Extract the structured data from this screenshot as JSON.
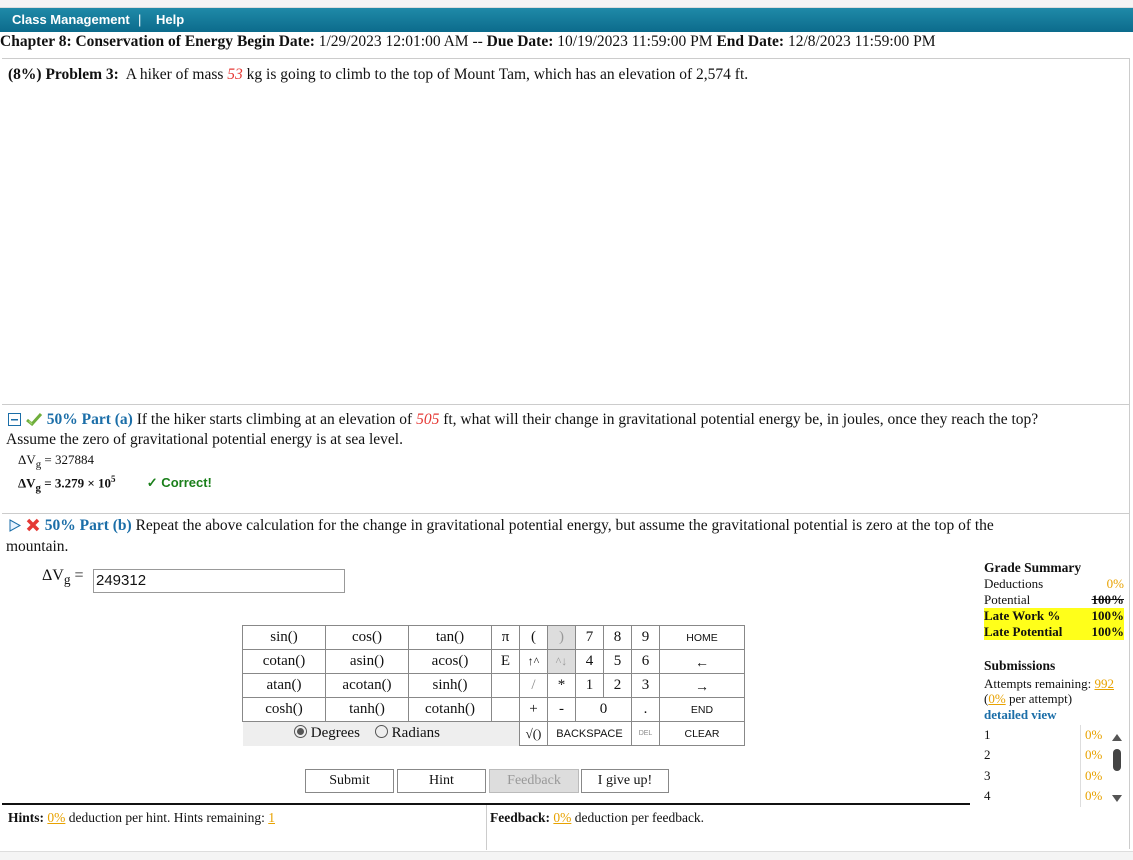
{
  "nav": {
    "class_management": "Class Management",
    "sep": "|",
    "help": "Help"
  },
  "chapter": {
    "title": "Chapter 8: Conservation of Energy",
    "begin_label": "Begin Date:",
    "begin": "1/29/2023 12:01:00 AM",
    "sep": "--",
    "due_label": "Due Date:",
    "due": "10/19/2023 11:59:00 PM",
    "end_label": "End Date:",
    "end": "12/8/2023 11:59:00 PM"
  },
  "problem": {
    "label": "(8%)  Problem 3:",
    "text1": "A hiker of mass",
    "mass": "53",
    "text2": "kg is going to climb to the top of Mount Tam, which has an elevation of 2,574 ft."
  },
  "part_a": {
    "label": "50% Part (a)",
    "text1": "If the hiker starts climbing at an elevation of",
    "elev": "505",
    "text2": "ft, what will their change in gravitational potential energy be, in joules, once they reach the top?",
    "text3": "Assume the zero of gravitational potential energy is at sea level.",
    "sym": "ΔV",
    "sub": "g",
    "eq": "= 327884",
    "eq2": "= 3.279 × 10",
    "exp": "5",
    "correct": "✓ Correct!"
  },
  "part_b": {
    "label": "50% Part (b)",
    "text1": "Repeat the above calculation for the change in gravitational potential energy, but assume the gravitational potential is zero at the top of the",
    "text2": "mountain.",
    "sym": "ΔV",
    "sub": "g",
    "eq": " = ",
    "input": "249312"
  },
  "keypad": {
    "f": [
      [
        "sin()",
        "cos()",
        "tan()"
      ],
      [
        "cotan()",
        "asin()",
        "acos()"
      ],
      [
        "atan()",
        "acotan()",
        "sinh()"
      ],
      [
        "cosh()",
        "tanh()",
        "cotanh()"
      ]
    ],
    "pi": "π",
    "e": "E",
    "lparen": "(",
    "rparen": ")",
    "up": "↑^",
    "dn": "^↓",
    "slash": "/",
    "star": "*",
    "plus": "+",
    "minus": "-",
    "sqrt": "√()",
    "digits": [
      "7",
      "8",
      "9",
      "4",
      "5",
      "6",
      "1",
      "2",
      "3",
      "0",
      "."
    ],
    "home": "HOME",
    "left": "←",
    "right": "→",
    "endk": "END",
    "backspace": "BACKSPACE",
    "del": "DEL",
    "clear": "CLEAR",
    "degrees": "Degrees",
    "radians": "Radians"
  },
  "buttons": {
    "submit": "Submit",
    "hint": "Hint",
    "feedback": "Feedback",
    "give_up": "I give up!"
  },
  "hints": {
    "label": "Hints:",
    "pct": "0%",
    "text": "deduction per hint. Hints remaining:",
    "remaining": "1"
  },
  "feedback": {
    "label": "Feedback:",
    "pct": "0%",
    "text": "deduction per feedback."
  },
  "grade": {
    "title": "Grade Summary",
    "deductions": "Deductions",
    "deductions_v": "0%",
    "potential": "Potential",
    "potential_v": "100%",
    "late_work": "Late Work %",
    "late_work_v": "100%",
    "late_pot": "Late Potential",
    "late_pot_v": "100%"
  },
  "submissions": {
    "title": "Submissions",
    "attempts": "Attempts remaining:",
    "attempts_v": "992",
    "per_pct": "0%",
    "per_text": "per attempt)",
    "lp": "(",
    "detailed": "detailed view",
    "rows": [
      {
        "n": "1",
        "v": "0%"
      },
      {
        "n": "2",
        "v": "0%"
      },
      {
        "n": "3",
        "v": "0%"
      },
      {
        "n": "4",
        "v": "0%"
      }
    ]
  }
}
